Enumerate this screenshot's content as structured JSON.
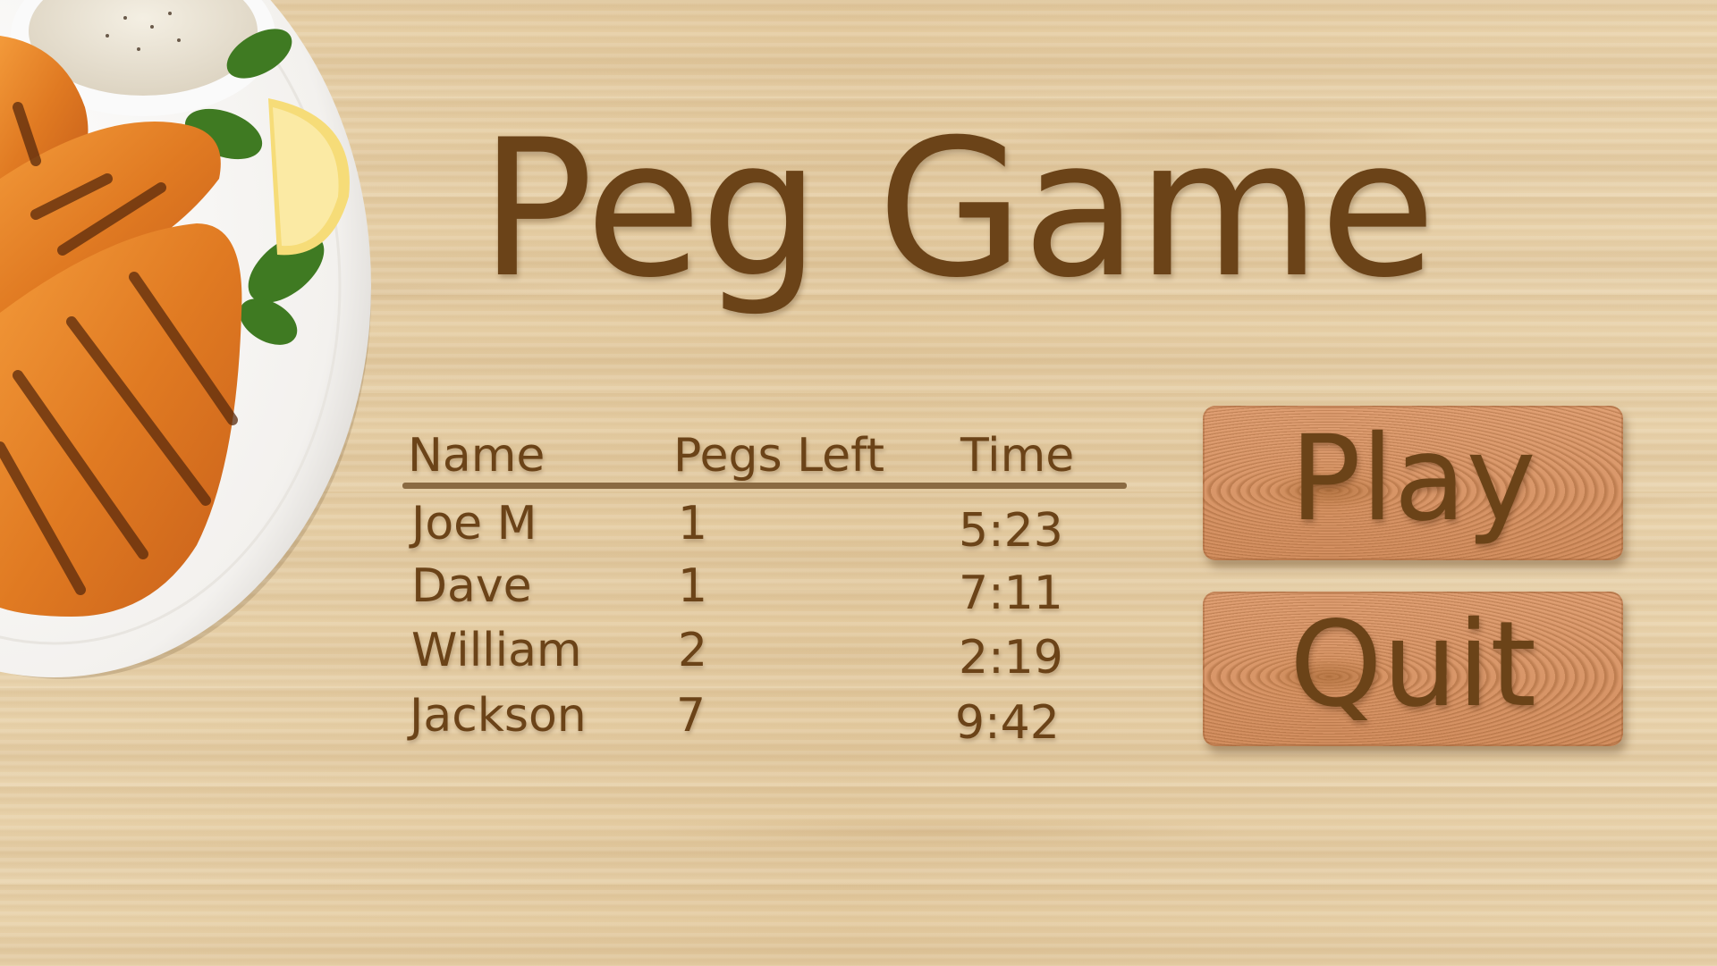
{
  "title": "Peg Game",
  "scoreboard": {
    "headers": {
      "name": "Name",
      "pegs": "Pegs Left",
      "time": "Time"
    },
    "rows": [
      {
        "name": "Joe M",
        "pegs": "1",
        "time": "5:23"
      },
      {
        "name": "Dave",
        "pegs": "1",
        "time": "7:11"
      },
      {
        "name": "William",
        "pegs": "2",
        "time": "2:19"
      },
      {
        "name": "Jackson",
        "pegs": "7",
        "time": "9:42"
      }
    ]
  },
  "buttons": {
    "play": "Play",
    "quit": "Quit"
  },
  "colors": {
    "text": "#6b4318",
    "table": "#e6cfa6",
    "button": "#d8956a"
  }
}
